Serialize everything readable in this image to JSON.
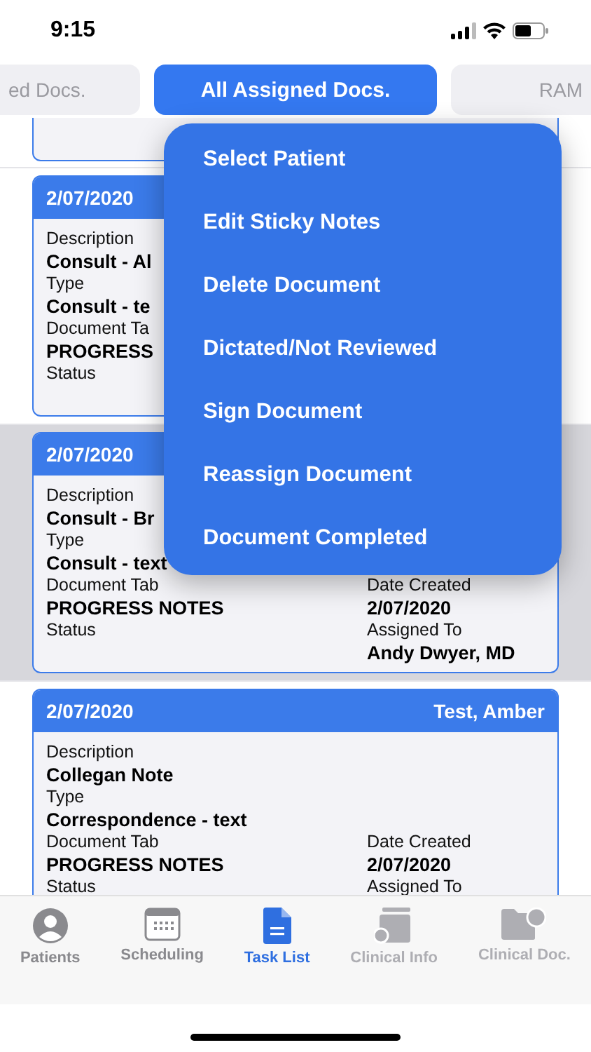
{
  "status_bar": {
    "time": "9:15"
  },
  "filter_tabs": [
    {
      "label": "ed Docs.",
      "selected": false
    },
    {
      "label": "All Assigned Docs.",
      "selected": true
    },
    {
      "label": "RAM",
      "selected": false
    }
  ],
  "documents": [
    {
      "date": "2/07/2020",
      "selected": false,
      "rows": [
        {
          "left": {
            "label": "Description",
            "value": "Consult - Al"
          }
        },
        {
          "left": {
            "label": "Type",
            "value": "Consult - te"
          }
        },
        {
          "left": {
            "label": "Document Ta",
            "value": "PROGRESS"
          }
        },
        {
          "left": {
            "label": "Status"
          }
        }
      ]
    },
    {
      "date": "2/07/2020",
      "selected": true,
      "rows": [
        {
          "left": {
            "label": "Description",
            "value": "Consult - Br"
          }
        },
        {
          "left": {
            "label": "Type",
            "value": "Consult - text"
          }
        },
        {
          "left": {
            "label": "Document Tab",
            "value": "PROGRESS NOTES"
          },
          "right": {
            "label": "Date Created",
            "value": "2/07/2020"
          }
        },
        {
          "left": {
            "label": "Status"
          },
          "right": {
            "label": "Assigned To",
            "value": "Andy Dwyer, MD"
          }
        }
      ]
    },
    {
      "date": "2/07/2020",
      "patient": "Test, Amber",
      "selected": false,
      "rows": [
        {
          "left": {
            "label": "Description",
            "value": "Collegan Note"
          }
        },
        {
          "left": {
            "label": "Type",
            "value": "Correspondence - text"
          }
        },
        {
          "left": {
            "label": "Document Tab",
            "value": "PROGRESS NOTES"
          },
          "right": {
            "label": "Date Created",
            "value": "2/07/2020"
          }
        },
        {
          "left": {
            "label": "Status"
          },
          "right": {
            "label": "Assigned To"
          }
        }
      ]
    }
  ],
  "context_menu": [
    "Select Patient",
    "Edit Sticky Notes",
    "Delete Document",
    "Dictated/Not Reviewed",
    "Sign Document",
    "Reassign Document",
    "Document Completed"
  ],
  "tab_bar": [
    {
      "label": "Patients",
      "kind": "person",
      "selected": false,
      "disabled": false
    },
    {
      "label": "Scheduling",
      "kind": "calendar",
      "selected": false,
      "disabled": false
    },
    {
      "label": "Task List",
      "kind": "document",
      "selected": true,
      "disabled": false
    },
    {
      "label": "Clinical Info",
      "kind": "chart",
      "selected": false,
      "disabled": true
    },
    {
      "label": "Clinical Doc.",
      "kind": "folder",
      "selected": false,
      "disabled": true
    }
  ]
}
